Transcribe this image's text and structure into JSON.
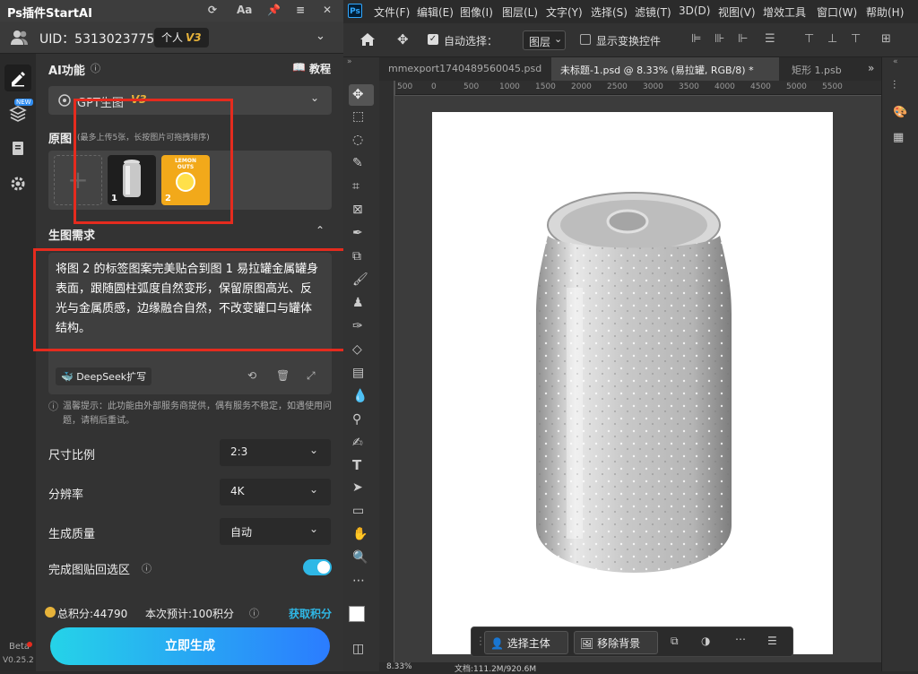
{
  "plugin": {
    "title": "Ps插件StartAI",
    "uid_text": "UID：5313023775",
    "plan_label": "个人",
    "plan_version": "V3",
    "ai_section_label": "AI功能",
    "tutorial_label": "教程",
    "gpt_model_label": "GPT生图",
    "gpt_model_version": "V3",
    "source_image_label": "原图",
    "source_image_hint": "(最多上传5张，长按图片可拖拽排序)",
    "thumbs": [
      {
        "num": "1"
      },
      {
        "num": "2",
        "label": "LEMON OUTS"
      }
    ],
    "requirement_label": "生图需求",
    "prompt_text": "将图 2 的标签图案完美贴合到图 1 易拉罐金属罐身表面，跟随圆柱弧度自然变形，保留原图高光、反光与金属质感，边缘融合自然，不改变罐口与罐体结构。",
    "deepseek_label": "DeepSeek扩写",
    "tip_text": "温馨提示：此功能由外部服务商提供，偶有服务不稳定，如遇使用问题，请稍后重试。",
    "ratio_label": "尺寸比例",
    "ratio_value": "2:3",
    "resolution_label": "分辨率",
    "resolution_value": "4K",
    "quality_label": "生成质量",
    "quality_value": "自动",
    "paste_back_label": "完成图贴回选区",
    "paste_back_enabled": true,
    "credits_text": "总积分:44790",
    "estimate_text": "本次预计:100积分",
    "get_credits_label": "获取积分",
    "generate_label": "立即生成",
    "beta_label": "Beta",
    "version_label": "V0.25.2"
  },
  "ps": {
    "logo": "Ps",
    "menus": [
      "文件(F)",
      "编辑(E)",
      "图像(I)",
      "图层(L)",
      "文字(Y)",
      "选择(S)",
      "滤镜(T)",
      "3D(D)",
      "视图(V)",
      "增效工具",
      "窗口(W)",
      "帮助(H)"
    ],
    "auto_select_label": "自动选择：",
    "layer_select_value": "图层",
    "show_transform_label": "显示变换控件",
    "tabs": [
      "mmexport1740489560045.psd",
      "未标题-1.psd @ 8.33% (易拉罐, RGB/8) *",
      "矩形 1.psb"
    ],
    "ruler_h": [
      "500",
      "0",
      "500",
      "1000",
      "1500",
      "2000",
      "2500",
      "3000",
      "3500",
      "4000",
      "4500",
      "5000",
      "5500"
    ],
    "ctx_select_subject": "选择主体",
    "ctx_remove_bg": "移除背景",
    "zoom": "8.33%",
    "doc_info": "文档:111.2M/920.6M"
  },
  "colors": {
    "accent": "#2b7cff",
    "cyan": "#25d3e8",
    "gold": "#e7b33a",
    "highlight": "#e52b1e"
  }
}
